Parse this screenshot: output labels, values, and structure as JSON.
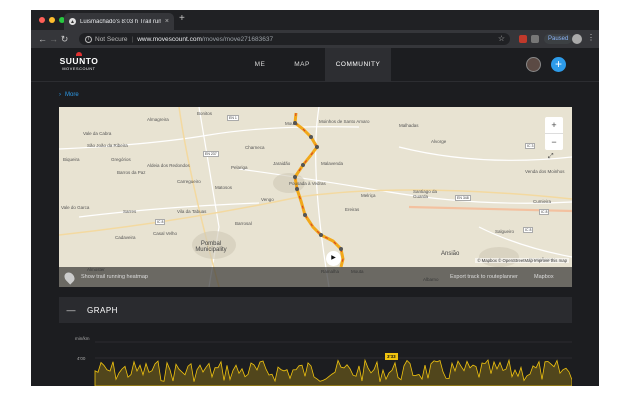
{
  "browser": {
    "tab_title": "Luismachado's 8:03 h Trail run",
    "tab_close": "×",
    "new_tab": "+",
    "not_secure": "Not Secure",
    "host": "www.movescount.com",
    "path": "/moves/move271683637",
    "profile_status": "Paused",
    "nav": {
      "back": "←",
      "forward": "→",
      "reload": "↻"
    },
    "icons": [
      "info-icon",
      "star-icon",
      "extension-icon",
      "avatar-icon",
      "menu-icon"
    ]
  },
  "site": {
    "logo_main": "SUUNTO",
    "logo_sub": "MOVESCOUNT",
    "nav": [
      "ME",
      "MAP",
      "COMMUNITY"
    ],
    "add_label": "+"
  },
  "more": "More",
  "map": {
    "towns": [
      "Almagreira",
      "Bonitos",
      "Vale da Cabra",
      "São João da Ribeira",
      "Biqueira",
      "Gregórios",
      "Aldeia dos Redondos",
      "Barros da Paz",
      "Carregueiro",
      "Matosos",
      "Pelariga",
      "Charneca",
      "Jaraidão",
      "Pousada à Vedras",
      "Malavenda",
      "Moinhos de Santo Amaro",
      "Mouta",
      "Malhadas",
      "Alvorge",
      "Santiago da Guarda",
      "Venda dos Moinhos",
      "Cumieira",
      "Vale do Garca",
      "Sarres",
      "Vila da Tabuas",
      "Cadaveira",
      "Casal Velho",
      "Pombal Municipality",
      "Barrosal",
      "Vengo",
      "Ereiras",
      "Melriça",
      "Ansião",
      "Ramalha",
      "Albarno",
      "Mouta",
      "Almoster",
      "Salgueiro",
      "Pousaflores"
    ],
    "roads": [
      "IC 8",
      "EN 1",
      "EN 237",
      "EN 348",
      "IC 8",
      "IC 3",
      "IC 8"
    ],
    "zoom_in": "+",
    "zoom_out": "−",
    "attribution": "© Mapbox © OpenStreetMap  Improve this map",
    "heatmap_label": "Show trail running heatmap",
    "export_label": "Export track to routeplanner",
    "mapbox_label": "Mapbox"
  },
  "graph": {
    "collapse_label": "—",
    "title": "GRAPH",
    "y_unit": "min/km",
    "y_tick": "4'00",
    "pace_badge": "3'33"
  }
}
